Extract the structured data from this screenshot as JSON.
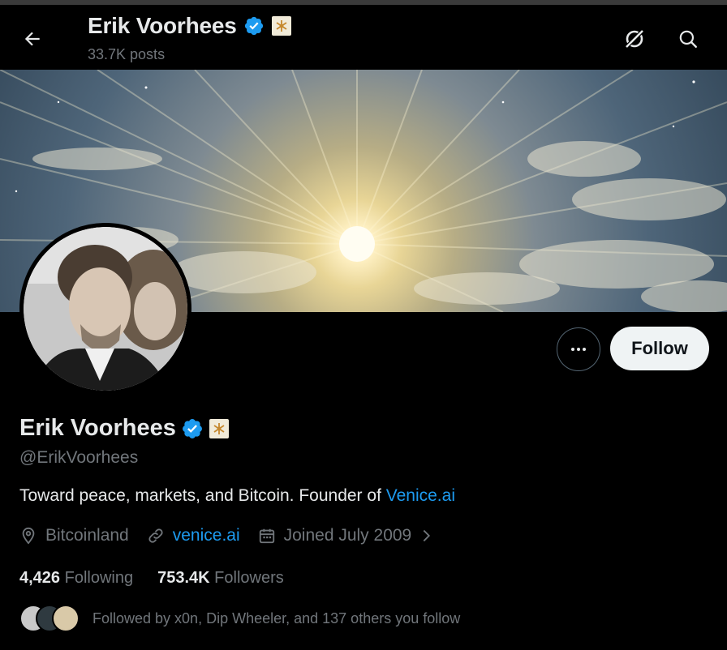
{
  "header": {
    "name": "Erik Voorhees",
    "posts": "33.7K posts"
  },
  "profile": {
    "name": "Erik Voorhees",
    "handle": "@ErikVoorhees",
    "bio_text": "Toward peace, markets, and Bitcoin. Founder of ",
    "bio_link": "Venice.ai",
    "location": "Bitcoinland",
    "website": "venice.ai",
    "joined": "Joined July 2009",
    "following_count": "4,426",
    "following_label": "Following",
    "followers_count": "753.4K",
    "followers_label": "Followers",
    "followed_by": "Followed by x0n, Dip Wheeler, and 137 others you follow"
  },
  "actions": {
    "follow_label": "Follow"
  },
  "icons": {
    "back": "arrow-left-icon",
    "grok": "grok-icon",
    "search": "search-icon",
    "verified": "verified-badge-icon",
    "affiliate": "affiliate-badge-icon",
    "more": "more-horizontal-icon",
    "location": "location-pin-icon",
    "link": "link-icon",
    "calendar": "calendar-icon",
    "chevron": "chevron-right-icon"
  },
  "colors": {
    "background": "#000000",
    "text_primary": "#e7e9ea",
    "text_secondary": "#71767b",
    "accent": "#1d9bf0",
    "verified": "#1d9bf0"
  }
}
